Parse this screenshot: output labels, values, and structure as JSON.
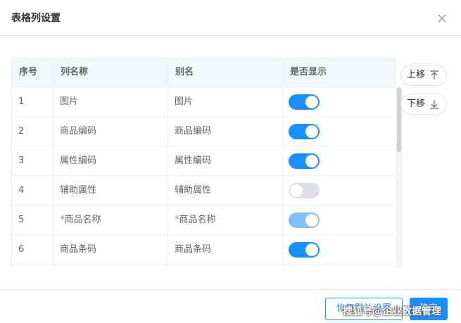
{
  "dialog": {
    "title": "表格列设置"
  },
  "table": {
    "columns": [
      "序号",
      "列名称",
      "别名",
      "是否显示"
    ],
    "rows": [
      {
        "index": "1",
        "name": "图片",
        "alias": "图片",
        "required": false,
        "visible": true,
        "disabled": false
      },
      {
        "index": "2",
        "name": "商品编码",
        "alias": "商品编码",
        "required": false,
        "visible": true,
        "disabled": false
      },
      {
        "index": "3",
        "name": "属性编码",
        "alias": "属性编码",
        "required": false,
        "visible": true,
        "disabled": false
      },
      {
        "index": "4",
        "name": "辅助属性",
        "alias": "辅助属性",
        "required": false,
        "visible": false,
        "disabled": false
      },
      {
        "index": "5",
        "name": "商品名称",
        "alias": "商品名称",
        "required": true,
        "required_mark": "*",
        "visible": true,
        "disabled": true
      },
      {
        "index": "6",
        "name": "商品条码",
        "alias": "商品条码",
        "required": false,
        "visible": true,
        "disabled": false
      }
    ]
  },
  "side_buttons": {
    "move_up": "上移",
    "move_down": "下移"
  },
  "footer": {
    "reset_label": "恢复默认设置",
    "ok_label": "确定"
  },
  "watermark": "搜狐号@企业数据管理",
  "colors": {
    "primary": "#1890ff",
    "switch_off": "#dcdfe6",
    "switch_disabled": "#7fbfff",
    "header_bg": "#f2f7fd",
    "required": "#f56c6c"
  },
  "icons": {
    "close": "close-icon",
    "up": "arrow-up-icon",
    "down": "arrow-down-icon"
  }
}
